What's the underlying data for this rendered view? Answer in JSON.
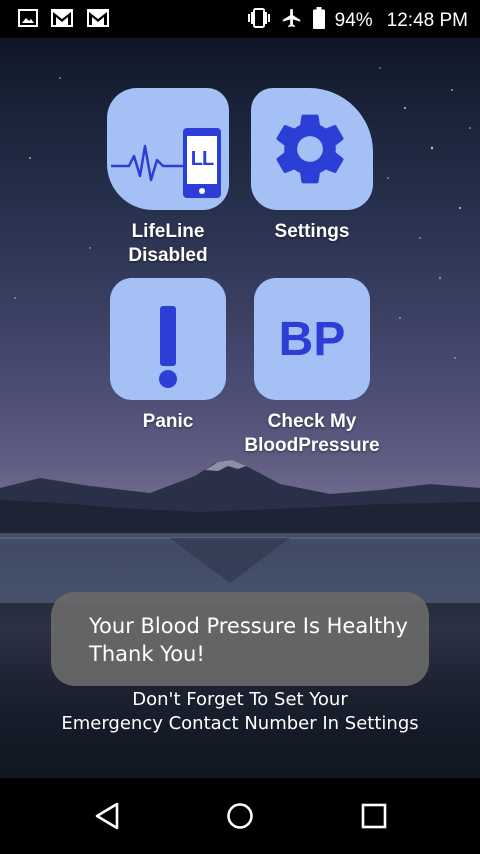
{
  "status_bar": {
    "left_icons": [
      "image-icon",
      "gmail-icon",
      "gmail-icon"
    ],
    "battery_percent": "94%",
    "time": "12:48 PM",
    "right_icons": [
      "vibrate-icon",
      "airplane-icon",
      "battery-icon"
    ]
  },
  "tiles": [
    {
      "id": "lifeline",
      "label_line1": "LifeLine",
      "label_line2": "Disabled",
      "icon": "lifeline-monitor-icon",
      "icon_text": "LL"
    },
    {
      "id": "settings",
      "label_line1": "Settings",
      "label_line2": "",
      "icon": "gear-icon"
    },
    {
      "id": "panic",
      "label_line1": "Panic",
      "label_line2": "",
      "icon": "exclamation-icon"
    },
    {
      "id": "bp",
      "label_line1": "Check My",
      "label_line2": "BloodPressure",
      "icon": "bp-icon",
      "icon_text": "BP"
    }
  ],
  "toast": {
    "line1": "Your Blood Pressure Is Healthy",
    "line2": "Thank You!"
  },
  "reminder": {
    "line1": "Don't Forget To Set Your",
    "line2": "Emergency Contact Number In Settings"
  },
  "nav": [
    "back-icon",
    "home-icon",
    "recents-icon"
  ],
  "colors": {
    "tile_bg": "#a5c0f5",
    "tile_icon": "#2b3fd6",
    "toast_bg": "#696969"
  }
}
